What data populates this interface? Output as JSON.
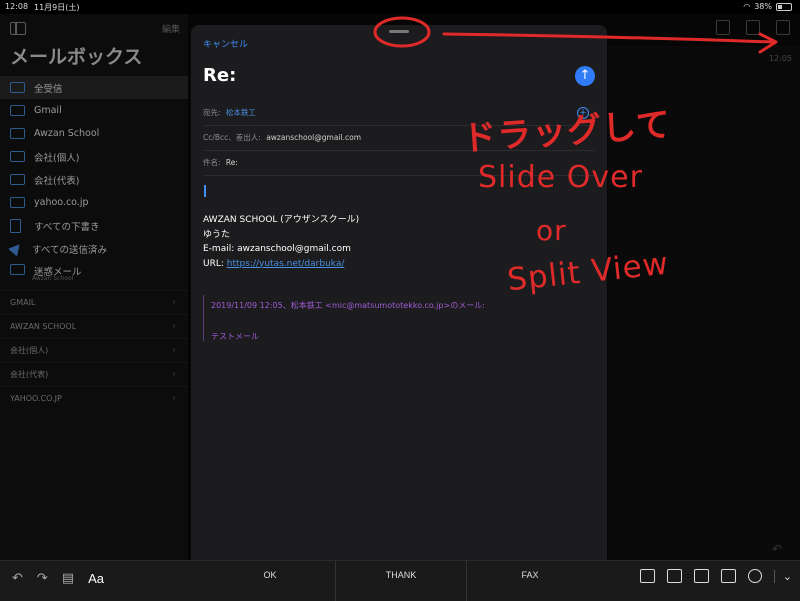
{
  "status": {
    "time": "12:08",
    "date": "11月9日(土)",
    "battery": "38%"
  },
  "sidebar": {
    "edit": "編集",
    "title": "メールボックス",
    "mailboxes": [
      {
        "label": "全受信",
        "icon": "inbox-icon"
      },
      {
        "label": "Gmail",
        "icon": "inbox-icon"
      },
      {
        "label": "Awzan School",
        "icon": "inbox-icon"
      },
      {
        "label": "会社(個人)",
        "icon": "inbox-icon"
      },
      {
        "label": "会社(代表)",
        "icon": "inbox-icon"
      },
      {
        "label": "yahoo.co.jp",
        "icon": "inbox-icon"
      },
      {
        "label": "すべての下書き",
        "icon": "draft-icon"
      },
      {
        "label": "すべての送信済み",
        "icon": "sent-icon"
      },
      {
        "label": "迷惑メール",
        "sub": "Awzan School",
        "icon": "junk-icon"
      }
    ],
    "accounts": [
      {
        "label": "GMAIL"
      },
      {
        "label": "AWZAN SCHOOL"
      },
      {
        "label": "会社(個人)"
      },
      {
        "label": "会社(代表)"
      },
      {
        "label": "YAHOO.CO.JP"
      }
    ]
  },
  "background": {
    "time": "12:05"
  },
  "compose": {
    "cancel": "キャンセル",
    "title": "Re:",
    "to_label": "宛先:",
    "to_value": "松本鉄工",
    "cc_label": "Cc/Bcc、差出人:",
    "cc_value": "awzanschool@gmail.com",
    "subject_label": "件名:",
    "subject_value": "Re:",
    "signature": {
      "line1": "AWZAN SCHOOL (アウザンスクール)",
      "line2": "ゆうた",
      "line3": "E-mail: awzanschool@gmail.com",
      "line4_prefix": "URL: ",
      "line4_link": "https://yutas.net/darbuka/"
    },
    "quote": {
      "header": "2019/11/09 12:05、松本鉄工 <mic@matsumototekko.co.jp>のメール:",
      "body": "テストメール"
    }
  },
  "annotations": {
    "line1": "ドラッグして",
    "line2": "Slide Over",
    "line3": "or",
    "line4": "Split View",
    "color": "#e02a2a"
  },
  "keyboard_bar": {
    "aa": "Aa",
    "suggestions": [
      "OK",
      "THANK",
      "FAX"
    ]
  }
}
